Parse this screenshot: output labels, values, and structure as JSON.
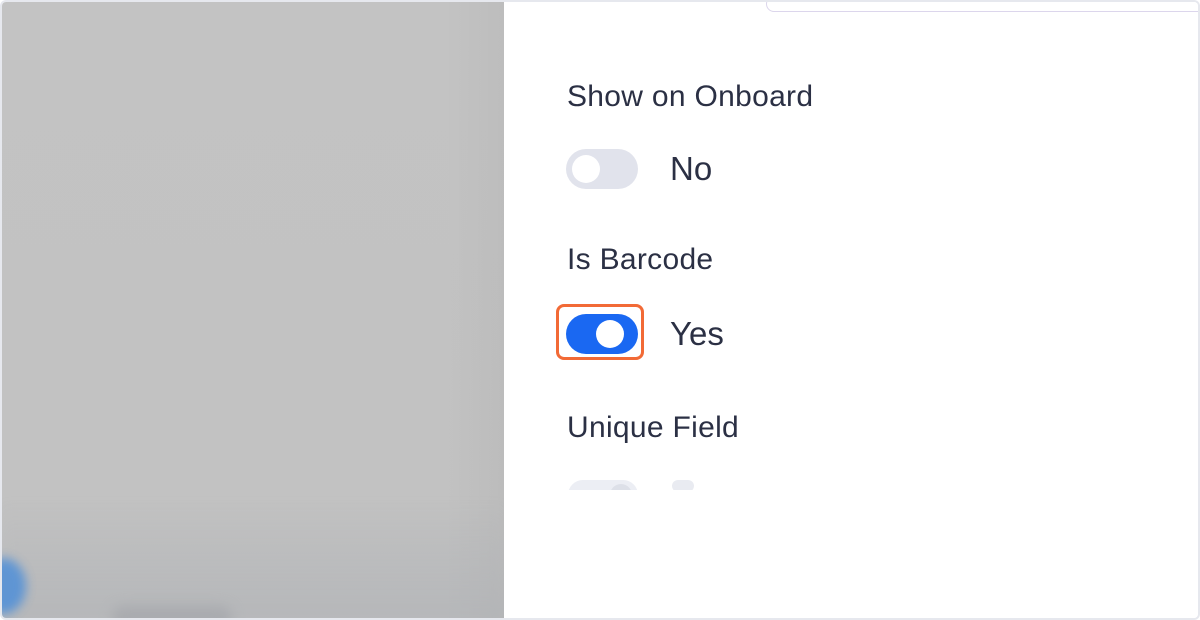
{
  "settings": {
    "show_on_onboard": {
      "label": "Show on Onboard",
      "value_text": "No",
      "enabled": false
    },
    "is_barcode": {
      "label": "Is Barcode",
      "value_text": "Yes",
      "enabled": true
    },
    "unique_field": {
      "label": "Unique Field"
    }
  },
  "colors": {
    "toggle_on": "#1a68f2",
    "toggle_off": "#e1e3ec",
    "highlight": "#f26a36",
    "text": "#2b3044"
  }
}
